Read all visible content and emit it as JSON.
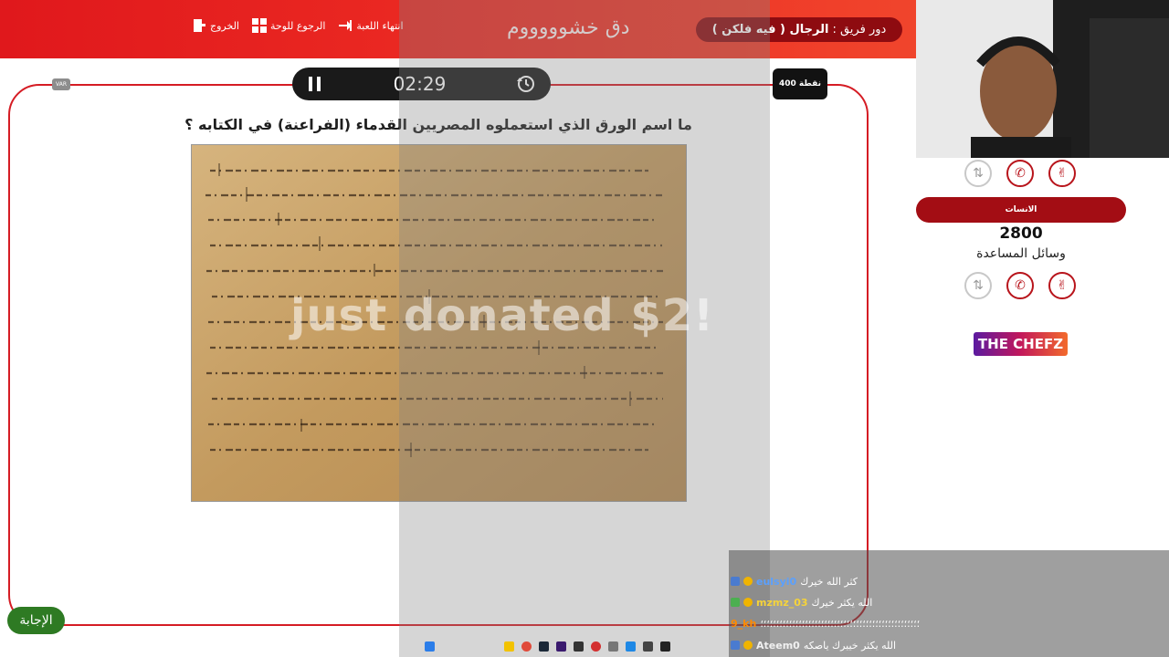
{
  "header": {
    "links": [
      {
        "label": "الخروج",
        "icon": "door-exit-icon"
      },
      {
        "label": "الرجوع للوحة",
        "icon": "grid-board-icon"
      },
      {
        "label": "انتهاء اللعبة",
        "icon": "arrow-end-icon"
      }
    ],
    "game_title": "دق خشوووووم",
    "team_turn_label": "دور فريق :",
    "team_turn_value": "الرجال ( فيه فلكن )"
  },
  "timer": {
    "time": "02:29"
  },
  "points_badge": "400 نقطة",
  "small_badge": "VAR",
  "question": "ما اسم الورق الذي استعملوه المصريين القدماء (الفراعنة) في الكتابه ؟",
  "donation_overlay": "just donated $2!",
  "answer_button": "الإجابة",
  "sidebar": {
    "team_name": "الانسات",
    "score": "2800",
    "help_label": "وسائل المساعدة",
    "sponsor": "THE CHEFZ"
  },
  "chat": [
    {
      "user": "eulsyi0",
      "message": "كثر الله خيرك",
      "color": "#5aa0ff"
    },
    {
      "user": "mzmz_03",
      "message": "الله يكثر خيرك",
      "color": "#f5d33a"
    },
    {
      "user": "9_kh",
      "message": "؛؛؛؛؛؛؛؛؛؛؛؛؛؛؛؛؛؛؛؛؛؛؛؛؛؛؛؛؛؛؛؛؛؛؛؛؛؛؛؛؛؛؛؛؛؛؛؛؛؛",
      "color": "#ff8a00"
    },
    {
      "user": "Ateem0",
      "message": "الله يكثر خييرك ياصكه",
      "color": "#f0f0f0"
    }
  ],
  "colors": {
    "brand_red": "#e0181c",
    "dark_red": "#8e0b10",
    "answer_green": "#2e7a23"
  }
}
